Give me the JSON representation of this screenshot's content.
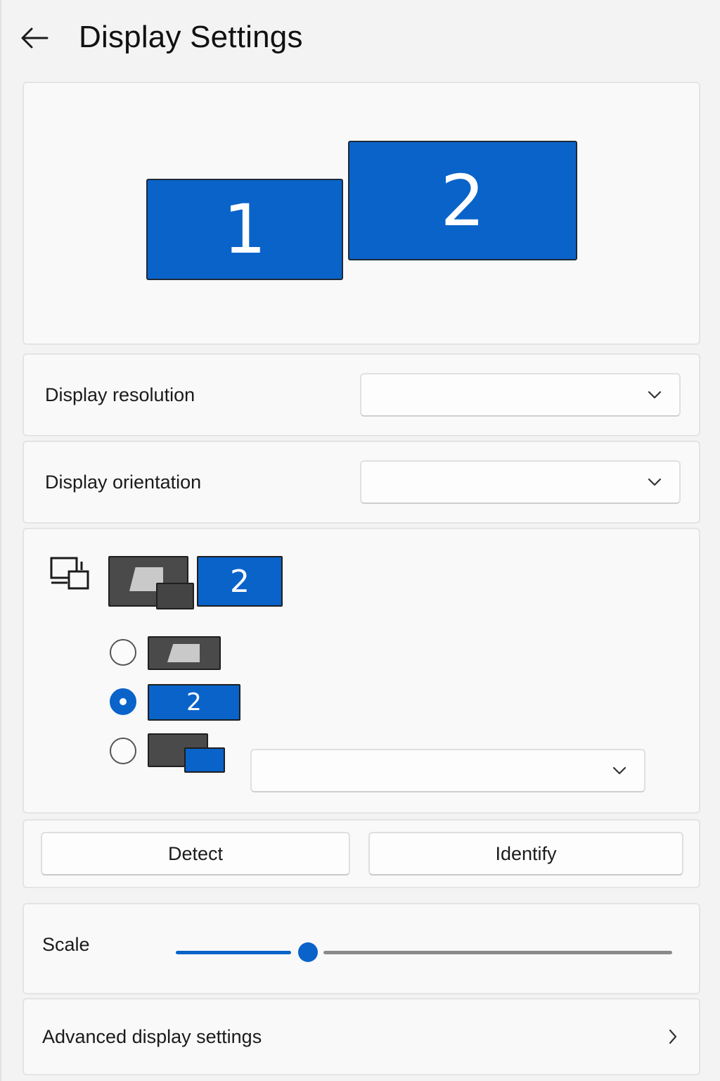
{
  "header": {
    "title": "Display Settings",
    "back_icon": "arrow-left-icon"
  },
  "arrangement": {
    "monitors": [
      {
        "label": "1",
        "color": "#0a63c9"
      },
      {
        "label": "2",
        "color": "#0a63c9"
      }
    ]
  },
  "resolution": {
    "label": "Display resolution",
    "value": ""
  },
  "orientation": {
    "label": "Display orientation",
    "value": ""
  },
  "multiple_displays": {
    "icon": "multiple-displays-icon",
    "current_mode_label": "2",
    "options": [
      {
        "mode": "duplicate",
        "selected": false,
        "label": ""
      },
      {
        "mode": "second-screen-only",
        "selected": true,
        "label": "2"
      },
      {
        "mode": "extend",
        "selected": false,
        "label": ""
      }
    ],
    "extend_dropdown_value": ""
  },
  "buttons": {
    "detect": "Detect",
    "identify": "Identify"
  },
  "scale": {
    "label": "Scale",
    "fraction": 0.27
  },
  "advanced": {
    "label": "Advanced display settings"
  },
  "colors": {
    "accent": "#0a63c9",
    "background": "#f3f3f3",
    "card": "#f9f9f9"
  }
}
